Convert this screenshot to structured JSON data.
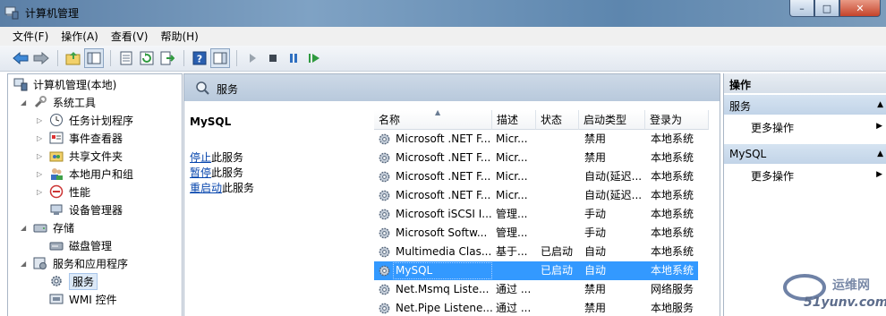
{
  "window": {
    "title": "计算机管理",
    "buttons": {
      "minimize": "–",
      "maximize": "□",
      "close": "✕"
    }
  },
  "menubar": [
    "文件(F)",
    "操作(A)",
    "查看(V)",
    "帮助(H)"
  ],
  "toolbar": {
    "icons": [
      "back-arrow-icon",
      "forward-arrow-icon",
      "up-folder-icon",
      "show-hide-console-tree-icon",
      "properties-icon",
      "refresh-icon",
      "export-list-icon",
      "help-icon",
      "show-hide-action-pane-icon",
      "start-service-icon",
      "stop-service-icon",
      "pause-service-icon",
      "restart-service-icon"
    ]
  },
  "tree": {
    "root": "计算机管理(本地)",
    "items": [
      {
        "label": "系统工具",
        "level": 1
      },
      {
        "label": "任务计划程序",
        "level": 2
      },
      {
        "label": "事件查看器",
        "level": 2
      },
      {
        "label": "共享文件夹",
        "level": 2
      },
      {
        "label": "本地用户和组",
        "level": 2
      },
      {
        "label": "性能",
        "level": 2
      },
      {
        "label": "设备管理器",
        "level": 2
      },
      {
        "label": "存储",
        "level": 1
      },
      {
        "label": "磁盘管理",
        "level": 2
      },
      {
        "label": "服务和应用程序",
        "level": 1
      },
      {
        "label": "服务",
        "level": 2
      },
      {
        "label": "WMI 控件",
        "level": 2
      }
    ]
  },
  "main": {
    "header": "服务",
    "selected_service": "MySQL",
    "links": [
      {
        "link": "停止",
        "rest": "此服务"
      },
      {
        "link": "暂停",
        "rest": "此服务"
      },
      {
        "link": "重启动",
        "rest": "此服务"
      }
    ],
    "columns": [
      "名称",
      "描述",
      "状态",
      "启动类型",
      "登录为"
    ],
    "rows": [
      [
        "Microsoft .NET F...",
        "Micr...",
        "",
        "禁用",
        "本地系统"
      ],
      [
        "Microsoft .NET F...",
        "Micr...",
        "",
        "禁用",
        "本地系统"
      ],
      [
        "Microsoft .NET F...",
        "Micr...",
        "",
        "自动(延迟...",
        "本地系统"
      ],
      [
        "Microsoft .NET F...",
        "Micr...",
        "",
        "自动(延迟...",
        "本地系统"
      ],
      [
        "Microsoft iSCSI I...",
        "管理...",
        "",
        "手动",
        "本地系统"
      ],
      [
        "Microsoft Softw...",
        "管理...",
        "",
        "手动",
        "本地系统"
      ],
      [
        "Multimedia Clas...",
        "基于...",
        "已启动",
        "自动",
        "本地系统"
      ],
      [
        "MySQL",
        "",
        "已启动",
        "自动",
        "本地系统"
      ],
      [
        "Net.Msmq Liste...",
        "通过 ...",
        "",
        "禁用",
        "网络服务"
      ],
      [
        "Net.Pipe Listene...",
        "通过 ...",
        "",
        "禁用",
        "本地服务"
      ]
    ],
    "selected_row": 7
  },
  "actions": {
    "title": "操作",
    "sections": [
      {
        "label": "服务",
        "item": "更多操作"
      },
      {
        "label": "MySQL",
        "item": "更多操作"
      }
    ]
  },
  "watermark": {
    "line1": "运维网",
    "line2": "51yunv.com"
  }
}
